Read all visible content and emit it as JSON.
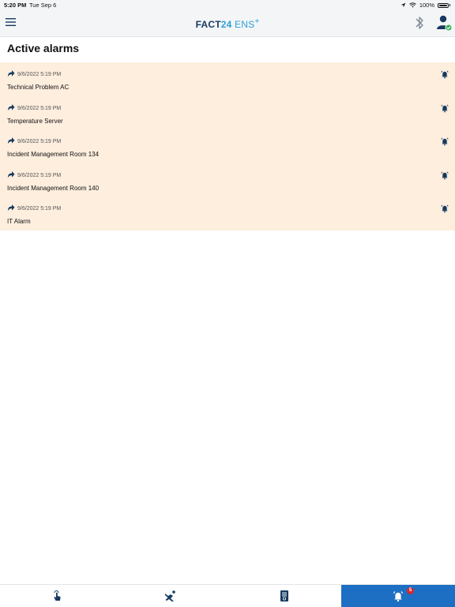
{
  "status_bar": {
    "time": "5:20 PM",
    "date": "Tue Sep 6",
    "battery": "100%"
  },
  "nav": {
    "brand_main": "FACT",
    "brand_num": "24",
    "brand_suffix": " ENS",
    "brand_plus": "+",
    "user_status_color": "#2db34a"
  },
  "page": {
    "title": "Active alarms"
  },
  "alarms": [
    {
      "timestamp": "9/6/2022 5:19 PM",
      "name": "Technical Problem AC"
    },
    {
      "timestamp": "9/6/2022 5:19 PM",
      "name": "Temperature Server"
    },
    {
      "timestamp": "9/6/2022 5:19 PM",
      "name": "Incident Management Room 134"
    },
    {
      "timestamp": "9/6/2022 5:19 PM",
      "name": "Incident Management Room 140"
    },
    {
      "timestamp": "9/6/2022 5:19 PM",
      "name": "IT Alarm"
    }
  ],
  "tabs": [
    {
      "icon": "touch-icon"
    },
    {
      "icon": "person-falling-icon"
    },
    {
      "icon": "document-icon"
    },
    {
      "icon": "alarm-bell-icon",
      "badge": "5",
      "active": true
    }
  ],
  "colors": {
    "accent": "#1c6fc2",
    "alarm_row_bg": "#fdeede",
    "badge": "#d9262b"
  }
}
